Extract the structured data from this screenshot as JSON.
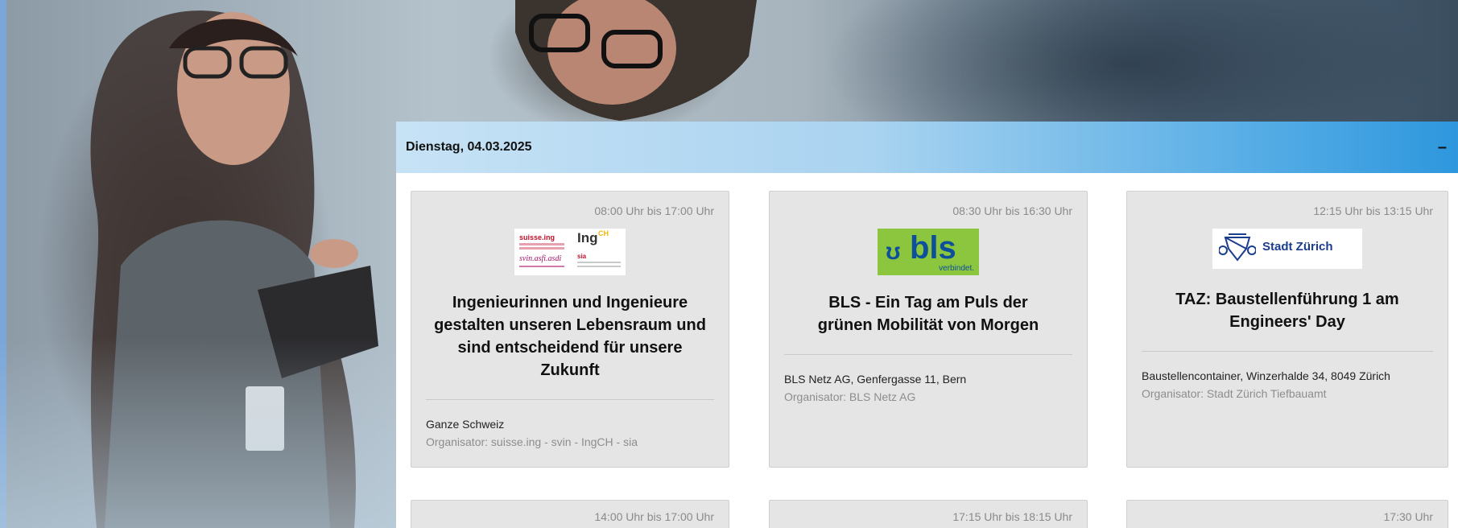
{
  "day": {
    "title": "Dienstag, 04.03.2025",
    "toggle": "–"
  },
  "events": [
    {
      "time": "08:00 Uhr bis 17:00 Uhr",
      "title": "Ingenieurinnen und Ingenieure gestalten unseren Lebensraum und sind entscheidend für unsere Zukunft",
      "location": "Ganze Schweiz",
      "organizer": "Organisator: suisse.ing - svin - IngCH - sia",
      "logo": {
        "name": "suisse-ing-logo",
        "texts": [
          "suisse.ing",
          "Ing",
          "CH",
          "svin.asfi.asdi",
          "sia"
        ]
      }
    },
    {
      "time": "08:30 Uhr bis 16:30 Uhr",
      "title": "BLS - Ein Tag am Puls der grünen Mobilität von Morgen",
      "location": "BLS Netz AG, Genfergasse 11, Bern",
      "organizer": "Organisator: BLS Netz AG",
      "logo": {
        "name": "bls-logo",
        "texts": [
          "bls",
          "verbindet."
        ],
        "color": "#8cc63f"
      }
    },
    {
      "time": "12:15 Uhr bis 13:15 Uhr",
      "title": "TAZ: Baustellenführung 1 am Engineers' Day",
      "location": "Baustellencontainer, Winzerhalde 34, 8049 Zürich",
      "organizer": "Organisator: Stadt Zürich Tiefbauamt",
      "logo": {
        "name": "stadt-zuerich-logo",
        "texts": [
          "Stadt Zürich"
        ],
        "color": "#1a3d8f"
      }
    },
    {
      "time": "14:00 Uhr bis 17:00 Uhr"
    },
    {
      "time": "17:15 Uhr bis 18:15 Uhr"
    },
    {
      "time": "17:30 Uhr"
    }
  ],
  "colors": {
    "header_gradient_start": "#c7e2f5",
    "header_gradient_end": "#2e97dd",
    "card_bg": "#e5e5e5",
    "bls_green": "#8cc63f",
    "bls_blue": "#0e4f9c",
    "zurich_blue": "#1a3d8f"
  }
}
